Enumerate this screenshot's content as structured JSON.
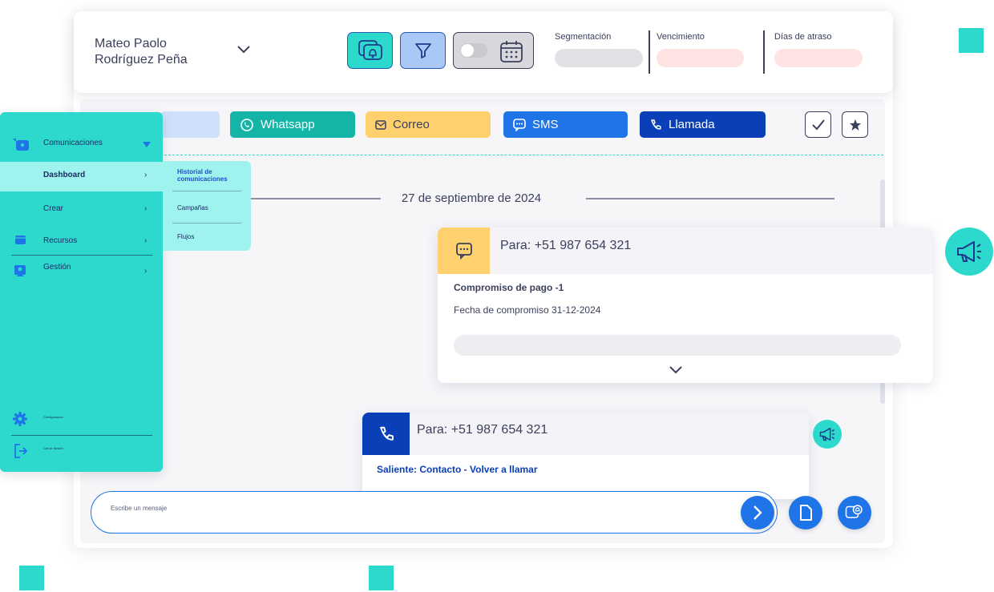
{
  "header": {
    "user_name_line1": "Mateo Paolo",
    "user_name_line2": "Rodríguez Peña",
    "segmentacion_label": "Segmentación",
    "vencimiento_label": "Vencimiento",
    "dias_atraso_label": "Días de atraso"
  },
  "channels": {
    "whatsapp": "Whatsapp",
    "correo": "Correo",
    "sms": "SMS",
    "llamada": "Llamada"
  },
  "timeline": {
    "date": "27 de septiembre de 2024"
  },
  "messages": [
    {
      "to": "Para: +51 987 654 321",
      "title": "Compromiso de pago -1",
      "detail": "Fecha de compromiso 31-12-2024"
    },
    {
      "to": "Para: +51 987 654 321",
      "title": "Saliente: Contacto - Volver a llamar"
    }
  ],
  "sidebar": {
    "section": "Comunicaciones",
    "items": [
      "Dashboard",
      "Crear",
      "Recursos",
      "Gestión"
    ],
    "submenu": [
      "Historial de comunicaciones",
      "Campañas",
      "Flujos"
    ],
    "footer": [
      "Configuración",
      "Cerrar Sesión"
    ]
  },
  "composer": {
    "placeholder": "Escribe un mensaje"
  },
  "colors": {
    "teal": "#2dd9cc",
    "whatsapp": "#14b4a6",
    "correo": "#ffd16e",
    "sms": "#1f74e8",
    "llamada": "#0b3fb8",
    "navy": "#1e2a66"
  }
}
